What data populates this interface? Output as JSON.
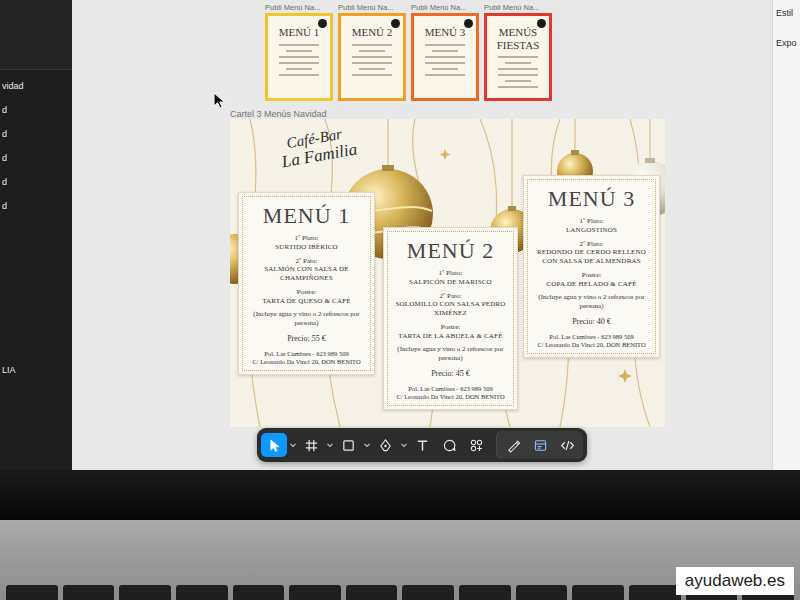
{
  "sidebar": {
    "items": [
      "vidad",
      "d",
      "d",
      "d",
      "d",
      "d"
    ],
    "lower_items": [
      "LIA"
    ]
  },
  "right_panel": {
    "items": [
      "Estil",
      "Expo"
    ]
  },
  "thumbnails": [
    {
      "label": "Publi Menú Na...",
      "title": "MENÚ 1",
      "color": "#f3c52c"
    },
    {
      "label": "Publi Menú Na...",
      "title": "MENÚ 2",
      "color": "#f2a024"
    },
    {
      "label": "Publi Menú Na...",
      "title": "MENÚ 3",
      "color": "#ec6a22"
    },
    {
      "label": "Publi Menú Na...",
      "title": "MENÚS FIESTAS",
      "color": "#e2382c"
    }
  ],
  "frame": {
    "title": "Cartel 3 Menús Navidad"
  },
  "poster": {
    "logo": [
      "Café-Bar",
      "La Familia"
    ],
    "menus": [
      {
        "title": "MENÚ 1",
        "courses": [
          {
            "label": "1º Plato:",
            "dish": "SURTIDO IBÉRICO"
          },
          {
            "label": "2º Pato:",
            "dish": "SALMÓN CON SALSA DE CHAMPIÑONES"
          },
          {
            "label": "Postre:",
            "dish": "TARTA DE QUESO & CAFÉ"
          }
        ],
        "note": "(Incluye agua y vino o 2 refrescos por persona)",
        "price": "Precio: 55 €",
        "footer": [
          "Pol. Las Cumbres - 623 989 509",
          "C/ Leonardo Da Vinci 20, DON BENITO"
        ]
      },
      {
        "title": "MENÚ 2",
        "courses": [
          {
            "label": "1º Plato:",
            "dish": "SALPICÓN DE MARISCO"
          },
          {
            "label": "2º Pato:",
            "dish": "SOLOMILLO CON SALSA PEDRO XIMÉNEZ"
          },
          {
            "label": "Postre:",
            "dish": "TARTA DE LA ABUELA & CAFÉ"
          }
        ],
        "note": "(Incluye agua y vino o 2 refrescos por persona)",
        "price": "Precio: 45 €",
        "footer": [
          "Pol. Las Cumbres - 623 989 509",
          "C/ Leonardo Da Vinci 20, DON BENITO"
        ]
      },
      {
        "title": "MENÚ 3",
        "courses": [
          {
            "label": "1º Plato:",
            "dish": "LANGOSTINOS"
          },
          {
            "label": "2º Plato:",
            "dish": "REDONDO DE CERDO RELLENO CON SALSA DE ALMENDRAS"
          },
          {
            "label": "Postre:",
            "dish": "COPA DE HELADO & CAFÉ"
          }
        ],
        "note": "(Incluye agua y vino o 2 refrescos por persona)",
        "price": "Precio: 40 €",
        "footer": [
          "Pol. Las Cumbres - 623 989 509",
          "C/ Leonardo Da Vinci 20, DON BENITO"
        ]
      }
    ]
  },
  "toolbar": {
    "tools": [
      {
        "kind": "move",
        "selected": true
      },
      {
        "kind": "frame",
        "selected": false
      },
      {
        "kind": "shape",
        "selected": false
      },
      {
        "kind": "pen",
        "selected": false
      },
      {
        "kind": "text",
        "selected": false
      },
      {
        "kind": "comment",
        "selected": false
      },
      {
        "kind": "actions",
        "selected": false
      },
      {
        "kind": "draw",
        "selected": false
      },
      {
        "kind": "dev",
        "selected": false
      },
      {
        "kind": "code",
        "selected": false
      }
    ]
  },
  "watermark": "ayudaweb.es"
}
